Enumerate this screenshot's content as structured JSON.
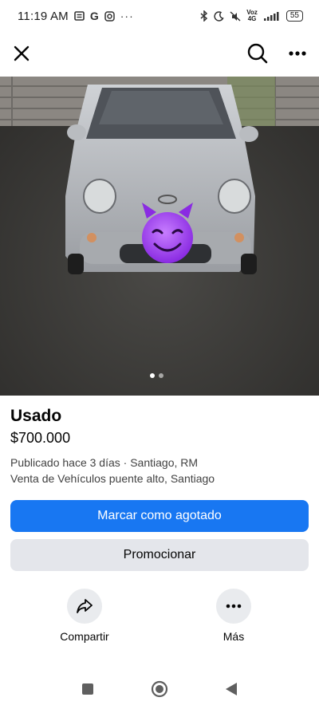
{
  "status_bar": {
    "time": "11:19 AM",
    "net_label_top": "Voz",
    "net_label_bottom": "4G",
    "battery": "55"
  },
  "listing": {
    "title": "Usado",
    "price": "$700.000",
    "published": "Publicado hace 3 días · Santiago, RM",
    "group": "Venta de Vehículos puente alto, Santiago",
    "photo_count": 2,
    "photo_index": 1
  },
  "buttons": {
    "mark_sold": "Marcar como agotado",
    "promote": "Promocionar"
  },
  "actions": {
    "share": "Compartir",
    "more": "Más"
  },
  "colors": {
    "primary": "#1877f2",
    "secondary_bg": "#e4e6eb"
  },
  "icons": {
    "close": "close-icon",
    "search": "search-icon",
    "more": "more-icon",
    "share": "share-icon",
    "emoji": "smiling-devil-emoji"
  }
}
